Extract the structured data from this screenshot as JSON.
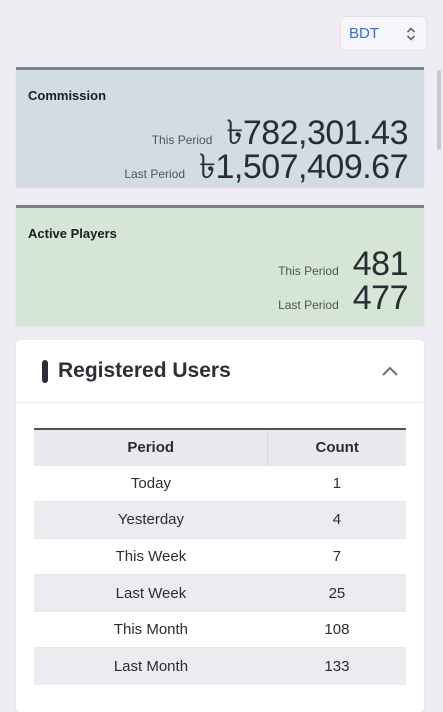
{
  "currency": {
    "selected": "BDT"
  },
  "commission": {
    "title": "Commission",
    "this_period_label": "This Period",
    "this_period_value": "৳782,301.43",
    "last_period_label": "Last Period",
    "last_period_value": "৳1,507,409.67"
  },
  "active_players": {
    "title": "Active Players",
    "this_period_label": "This Period",
    "this_period_value": "481",
    "last_period_label": "Last Period",
    "last_period_value": "477"
  },
  "registered_users": {
    "title": "Registered Users",
    "columns": [
      "Period",
      "Count"
    ],
    "rows": [
      {
        "period": "Today",
        "count": "1"
      },
      {
        "period": "Yesterday",
        "count": "4"
      },
      {
        "period": "This Week",
        "count": "7"
      },
      {
        "period": "Last Week",
        "count": "25"
      },
      {
        "period": "This Month",
        "count": "108"
      },
      {
        "period": "Last Month",
        "count": "133"
      }
    ]
  },
  "icons": {
    "currency_select": "chevron-up-down-icon",
    "collapse": "chevron-up-icon"
  },
  "colors": {
    "commission_card": "#d2dce3",
    "players_card": "#d6e6d6",
    "accent": "#2f6fd1"
  }
}
